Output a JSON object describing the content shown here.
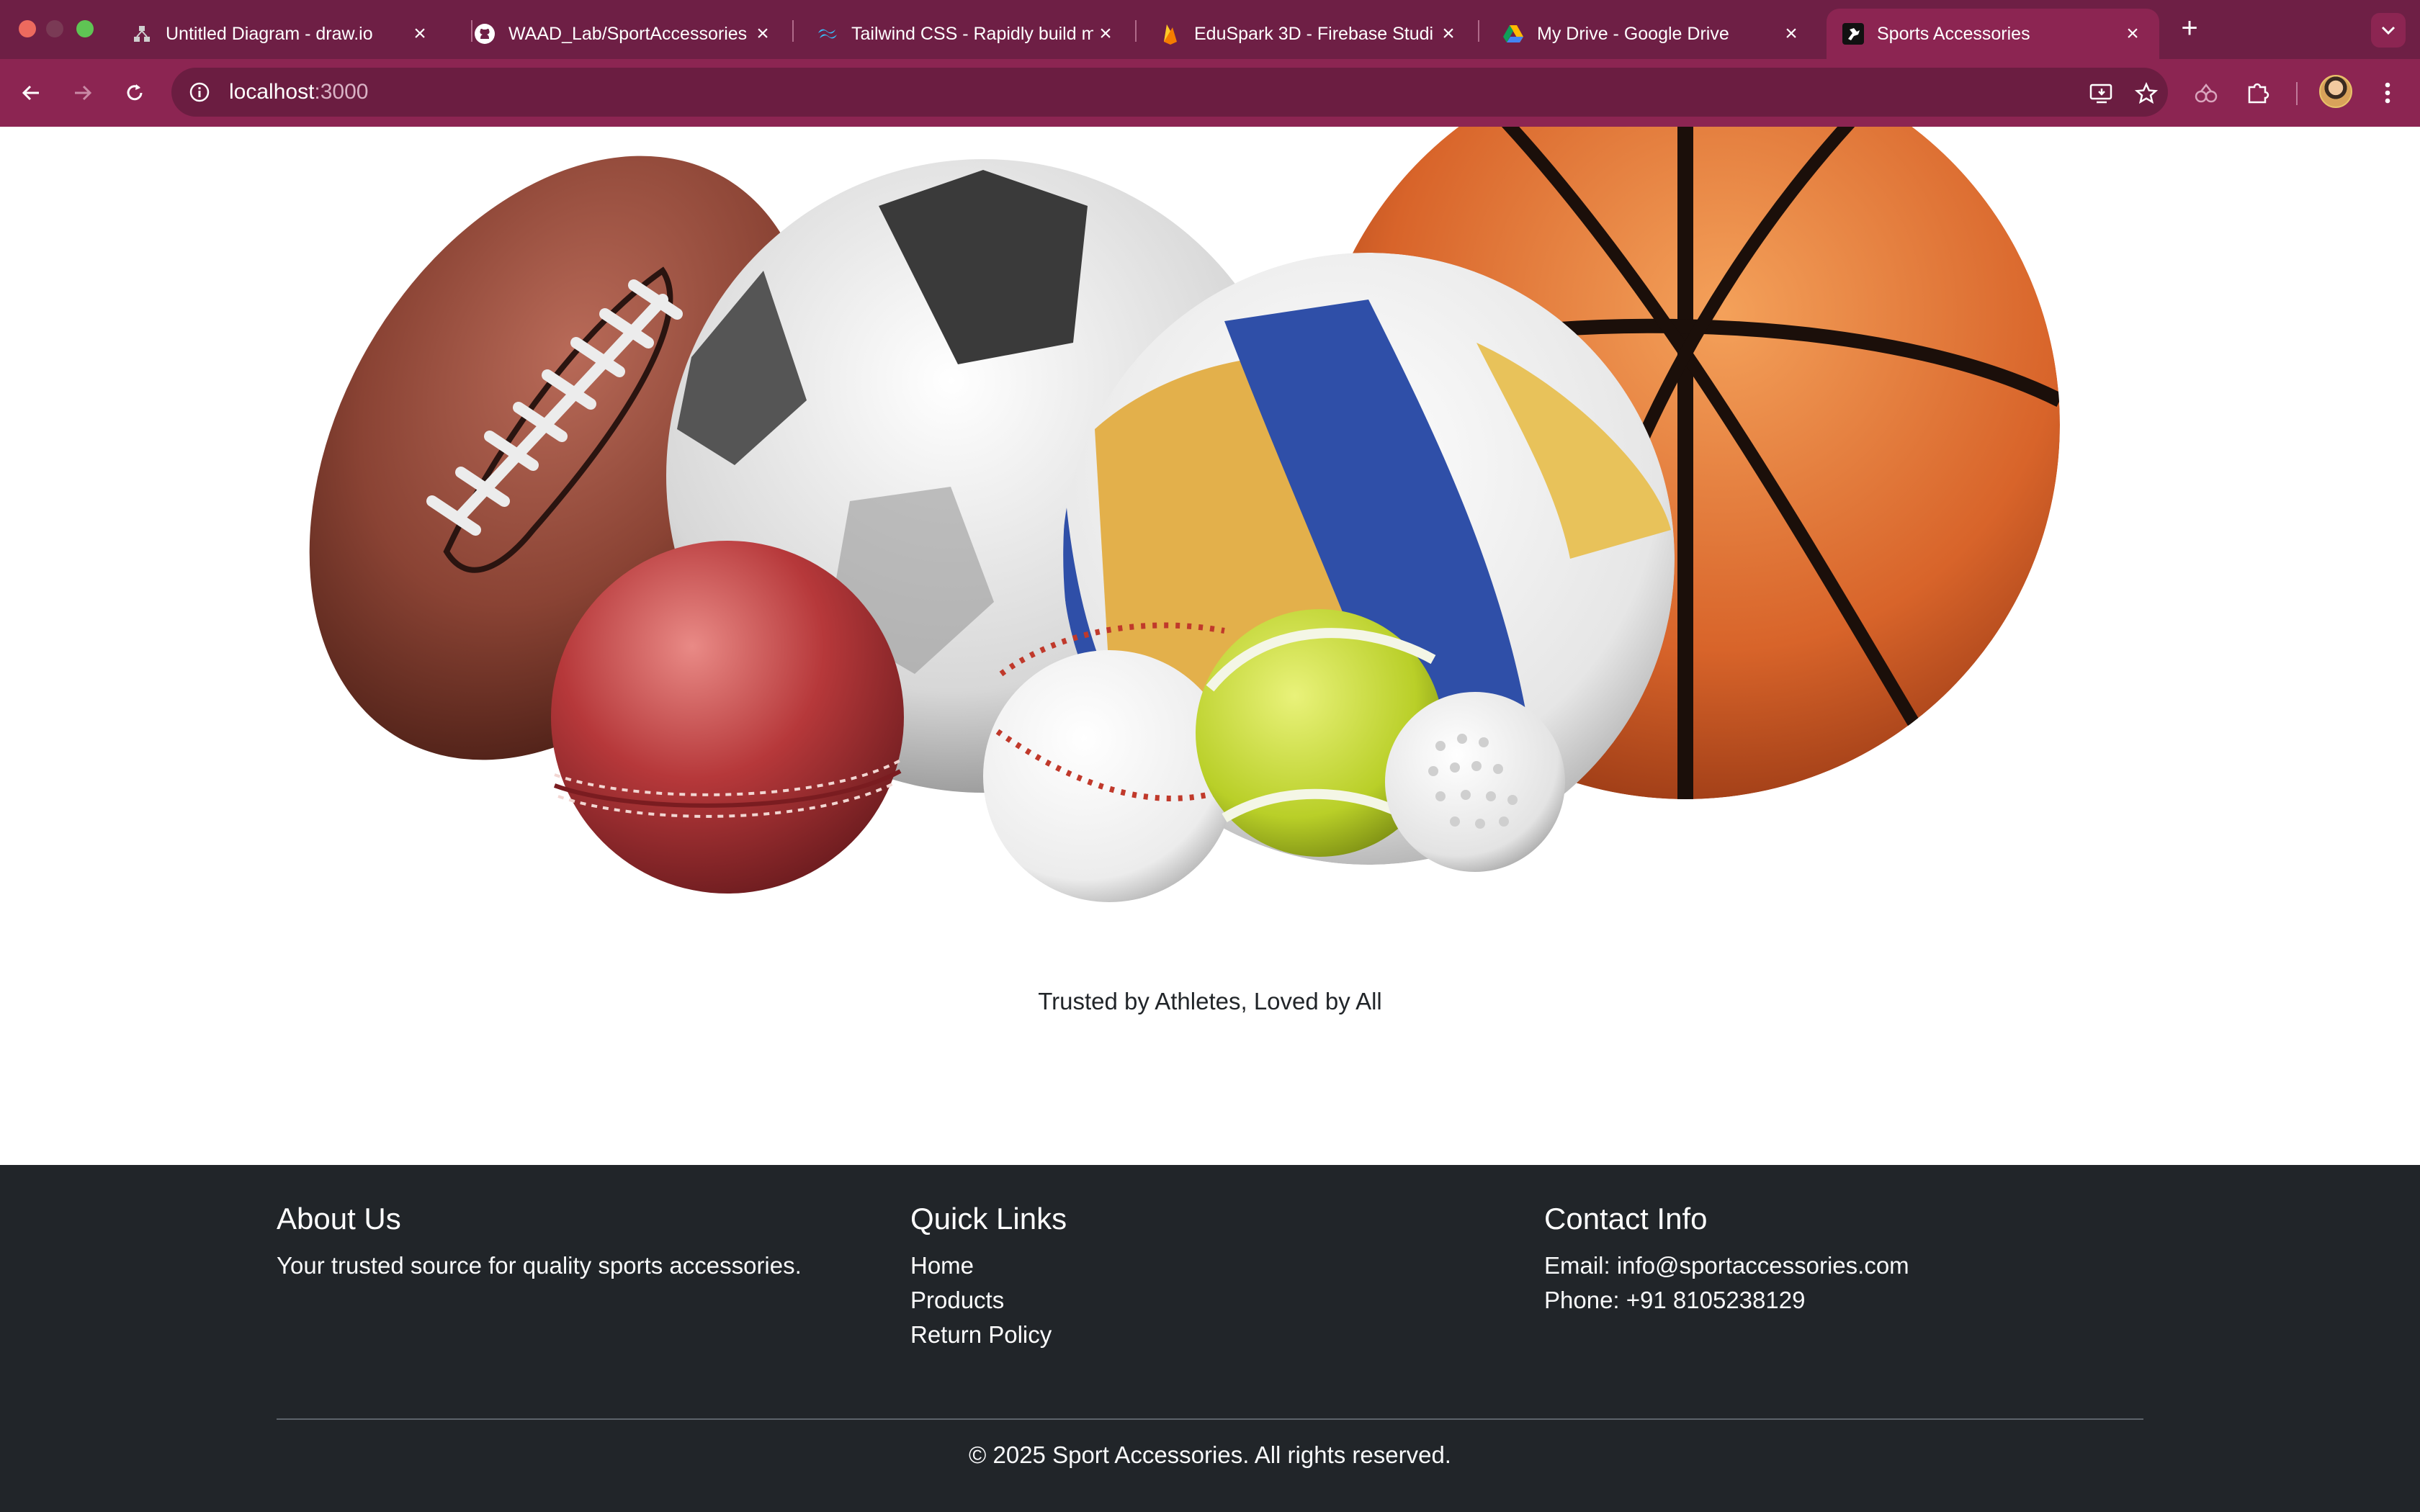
{
  "browser": {
    "tabs": [
      {
        "title": "Untitled Diagram - draw.io",
        "icon": "drawio-icon"
      },
      {
        "title": "WAAD_Lab/SportAccessories",
        "icon": "github-icon"
      },
      {
        "title": "Tailwind CSS - Rapidly build m",
        "icon": "tailwind-icon"
      },
      {
        "title": "EduSpark 3D - Firebase Studi",
        "icon": "firebase-icon"
      },
      {
        "title": "My Drive - Google Drive",
        "icon": "google-drive-icon"
      },
      {
        "title": "Sports Accessories",
        "icon": "site-favicon"
      }
    ],
    "active_tab": 5,
    "url_host": "localhost",
    "url_port": ":3000",
    "theme_color": "#8c2552"
  },
  "hero": {
    "image_alt": "Assorted sports balls: american football, soccer ball, volleyball, basketball, cricket ball, baseball, tennis ball, golf ball"
  },
  "tagline": "Trusted by Athletes, Loved by All",
  "footer": {
    "about": {
      "heading": "About Us",
      "text": "Your trusted source for quality sports accessories."
    },
    "links": {
      "heading": "Quick Links",
      "items": [
        "Home",
        "Products",
        "Return Policy"
      ]
    },
    "contact": {
      "heading": "Contact Info",
      "email": "Email: info@sportaccessories.com",
      "phone": "Phone: +91 8105238129"
    },
    "copyright": "© 2025 Sport Accessories. All rights reserved.",
    "bg_color": "#212529"
  }
}
